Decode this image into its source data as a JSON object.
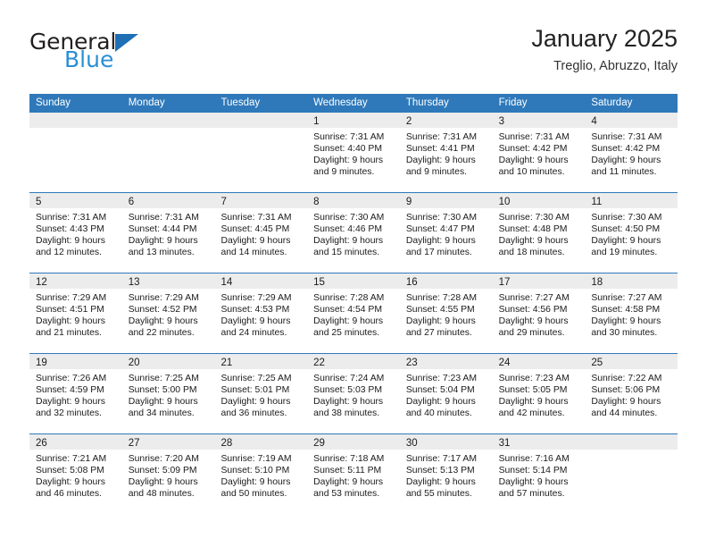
{
  "brand": {
    "word1": "General",
    "word2": "Blue",
    "triangle_color": "#1f6fb5",
    "blue_color": "#2a8fd4",
    "logo_icon": "general-blue-logo"
  },
  "header": {
    "title": "January 2025",
    "subtitle": "Treglio, Abruzzo, Italy"
  },
  "theme": {
    "header_blue": "#2f79ba",
    "day_band_gray": "#ececec",
    "text": "#1b1b1b"
  },
  "weekdays": [
    "Sunday",
    "Monday",
    "Tuesday",
    "Wednesday",
    "Thursday",
    "Friday",
    "Saturday"
  ],
  "weeks": [
    [
      {
        "day": "",
        "lines": []
      },
      {
        "day": "",
        "lines": []
      },
      {
        "day": "",
        "lines": []
      },
      {
        "day": "1",
        "lines": [
          "Sunrise: 7:31 AM",
          "Sunset: 4:40 PM",
          "Daylight: 9 hours",
          "and 9 minutes."
        ]
      },
      {
        "day": "2",
        "lines": [
          "Sunrise: 7:31 AM",
          "Sunset: 4:41 PM",
          "Daylight: 9 hours",
          "and 9 minutes."
        ]
      },
      {
        "day": "3",
        "lines": [
          "Sunrise: 7:31 AM",
          "Sunset: 4:42 PM",
          "Daylight: 9 hours",
          "and 10 minutes."
        ]
      },
      {
        "day": "4",
        "lines": [
          "Sunrise: 7:31 AM",
          "Sunset: 4:42 PM",
          "Daylight: 9 hours",
          "and 11 minutes."
        ]
      }
    ],
    [
      {
        "day": "5",
        "lines": [
          "Sunrise: 7:31 AM",
          "Sunset: 4:43 PM",
          "Daylight: 9 hours",
          "and 12 minutes."
        ]
      },
      {
        "day": "6",
        "lines": [
          "Sunrise: 7:31 AM",
          "Sunset: 4:44 PM",
          "Daylight: 9 hours",
          "and 13 minutes."
        ]
      },
      {
        "day": "7",
        "lines": [
          "Sunrise: 7:31 AM",
          "Sunset: 4:45 PM",
          "Daylight: 9 hours",
          "and 14 minutes."
        ]
      },
      {
        "day": "8",
        "lines": [
          "Sunrise: 7:30 AM",
          "Sunset: 4:46 PM",
          "Daylight: 9 hours",
          "and 15 minutes."
        ]
      },
      {
        "day": "9",
        "lines": [
          "Sunrise: 7:30 AM",
          "Sunset: 4:47 PM",
          "Daylight: 9 hours",
          "and 17 minutes."
        ]
      },
      {
        "day": "10",
        "lines": [
          "Sunrise: 7:30 AM",
          "Sunset: 4:48 PM",
          "Daylight: 9 hours",
          "and 18 minutes."
        ]
      },
      {
        "day": "11",
        "lines": [
          "Sunrise: 7:30 AM",
          "Sunset: 4:50 PM",
          "Daylight: 9 hours",
          "and 19 minutes."
        ]
      }
    ],
    [
      {
        "day": "12",
        "lines": [
          "Sunrise: 7:29 AM",
          "Sunset: 4:51 PM",
          "Daylight: 9 hours",
          "and 21 minutes."
        ]
      },
      {
        "day": "13",
        "lines": [
          "Sunrise: 7:29 AM",
          "Sunset: 4:52 PM",
          "Daylight: 9 hours",
          "and 22 minutes."
        ]
      },
      {
        "day": "14",
        "lines": [
          "Sunrise: 7:29 AM",
          "Sunset: 4:53 PM",
          "Daylight: 9 hours",
          "and 24 minutes."
        ]
      },
      {
        "day": "15",
        "lines": [
          "Sunrise: 7:28 AM",
          "Sunset: 4:54 PM",
          "Daylight: 9 hours",
          "and 25 minutes."
        ]
      },
      {
        "day": "16",
        "lines": [
          "Sunrise: 7:28 AM",
          "Sunset: 4:55 PM",
          "Daylight: 9 hours",
          "and 27 minutes."
        ]
      },
      {
        "day": "17",
        "lines": [
          "Sunrise: 7:27 AM",
          "Sunset: 4:56 PM",
          "Daylight: 9 hours",
          "and 29 minutes."
        ]
      },
      {
        "day": "18",
        "lines": [
          "Sunrise: 7:27 AM",
          "Sunset: 4:58 PM",
          "Daylight: 9 hours",
          "and 30 minutes."
        ]
      }
    ],
    [
      {
        "day": "19",
        "lines": [
          "Sunrise: 7:26 AM",
          "Sunset: 4:59 PM",
          "Daylight: 9 hours",
          "and 32 minutes."
        ]
      },
      {
        "day": "20",
        "lines": [
          "Sunrise: 7:25 AM",
          "Sunset: 5:00 PM",
          "Daylight: 9 hours",
          "and 34 minutes."
        ]
      },
      {
        "day": "21",
        "lines": [
          "Sunrise: 7:25 AM",
          "Sunset: 5:01 PM",
          "Daylight: 9 hours",
          "and 36 minutes."
        ]
      },
      {
        "day": "22",
        "lines": [
          "Sunrise: 7:24 AM",
          "Sunset: 5:03 PM",
          "Daylight: 9 hours",
          "and 38 minutes."
        ]
      },
      {
        "day": "23",
        "lines": [
          "Sunrise: 7:23 AM",
          "Sunset: 5:04 PM",
          "Daylight: 9 hours",
          "and 40 minutes."
        ]
      },
      {
        "day": "24",
        "lines": [
          "Sunrise: 7:23 AM",
          "Sunset: 5:05 PM",
          "Daylight: 9 hours",
          "and 42 minutes."
        ]
      },
      {
        "day": "25",
        "lines": [
          "Sunrise: 7:22 AM",
          "Sunset: 5:06 PM",
          "Daylight: 9 hours",
          "and 44 minutes."
        ]
      }
    ],
    [
      {
        "day": "26",
        "lines": [
          "Sunrise: 7:21 AM",
          "Sunset: 5:08 PM",
          "Daylight: 9 hours",
          "and 46 minutes."
        ]
      },
      {
        "day": "27",
        "lines": [
          "Sunrise: 7:20 AM",
          "Sunset: 5:09 PM",
          "Daylight: 9 hours",
          "and 48 minutes."
        ]
      },
      {
        "day": "28",
        "lines": [
          "Sunrise: 7:19 AM",
          "Sunset: 5:10 PM",
          "Daylight: 9 hours",
          "and 50 minutes."
        ]
      },
      {
        "day": "29",
        "lines": [
          "Sunrise: 7:18 AM",
          "Sunset: 5:11 PM",
          "Daylight: 9 hours",
          "and 53 minutes."
        ]
      },
      {
        "day": "30",
        "lines": [
          "Sunrise: 7:17 AM",
          "Sunset: 5:13 PM",
          "Daylight: 9 hours",
          "and 55 minutes."
        ]
      },
      {
        "day": "31",
        "lines": [
          "Sunrise: 7:16 AM",
          "Sunset: 5:14 PM",
          "Daylight: 9 hours",
          "and 57 minutes."
        ]
      },
      {
        "day": "",
        "lines": []
      }
    ]
  ]
}
